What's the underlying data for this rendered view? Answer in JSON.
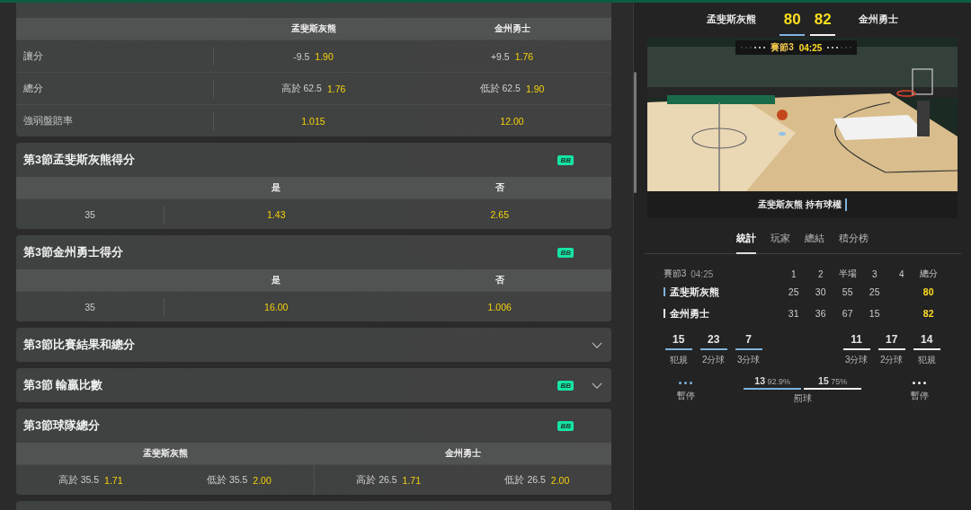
{
  "markets": [
    {
      "kind": "grid",
      "expanded": true,
      "columns": [
        "孟斐斯灰熊",
        "金州勇士"
      ],
      "rows": [
        {
          "label": "讓分",
          "cells": [
            {
              "line": "-9.5",
              "odds": "1.90"
            },
            {
              "line": "+9.5",
              "odds": "1.76"
            }
          ]
        },
        {
          "label": "總分",
          "cells": [
            {
              "line": "高於 62.5",
              "odds": "1.76"
            },
            {
              "line": "低於 62.5",
              "odds": "1.90"
            }
          ]
        },
        {
          "label": "強弱盤賠率",
          "cells": [
            {
              "odds": "1.015"
            },
            {
              "odds": "12.00"
            }
          ]
        }
      ]
    },
    {
      "kind": "line",
      "title": "第3節孟斐斯灰熊得分",
      "badge": "BB",
      "expanded": true,
      "columns": [
        "是",
        "否"
      ],
      "rows": [
        {
          "label": "35",
          "cells": [
            {
              "odds": "1.43"
            },
            {
              "odds": "2.65"
            }
          ]
        }
      ]
    },
    {
      "kind": "line",
      "title": "第3節金州勇士得分",
      "badge": "BB",
      "expanded": true,
      "columns": [
        "是",
        "否"
      ],
      "rows": [
        {
          "label": "35",
          "cells": [
            {
              "odds": "16.00"
            },
            {
              "odds": "1.006"
            }
          ]
        }
      ]
    },
    {
      "kind": "line",
      "title": "第3節比賽結果和總分",
      "expanded": false
    },
    {
      "kind": "line",
      "title": "第3節 輸贏比數",
      "badge": "BB",
      "expanded": false
    },
    {
      "kind": "teams",
      "title": "第3節球隊總分",
      "badge": "BB",
      "expanded": true,
      "columns": [
        "孟斐斯灰熊",
        "金州勇士"
      ],
      "rows": [
        {
          "cells": [
            {
              "line": "高於 35.5",
              "odds": "1.71"
            },
            {
              "line": "低於 35.5",
              "odds": "2.00"
            },
            {
              "line": "高於 26.5",
              "odds": "1.71"
            },
            {
              "line": "低於 26.5",
              "odds": "2.00"
            }
          ]
        }
      ]
    },
    {
      "kind": "stub",
      "expanded": false
    }
  ],
  "match": {
    "teams": [
      {
        "name": "孟斐斯灰熊",
        "score": "80",
        "color": "#7eb3dc"
      },
      {
        "name": "金州勇士",
        "score": "82",
        "color": "#f2f2f2"
      }
    ],
    "clock": {
      "period": "賽節3",
      "time": "04:25"
    },
    "possession": "孟斐斯灰熊 持有球權",
    "tabs": [
      {
        "label": "統計",
        "selected": true
      },
      {
        "label": "玩家",
        "selected": false
      },
      {
        "label": "總結",
        "selected": false
      },
      {
        "label": "積分榜",
        "selected": false
      }
    ],
    "table": {
      "period": "賽節3",
      "time": "04:25",
      "columns": [
        "1",
        "2",
        "半場",
        "3",
        "4",
        "總分"
      ],
      "rows": [
        {
          "team": "孟斐斯灰熊",
          "q1": "25",
          "q2": "30",
          "half": "55",
          "q3": "25",
          "total": "80"
        },
        {
          "team": "金州勇士",
          "q1": "31",
          "q2": "36",
          "half": "67",
          "q3": "15",
          "total": "82"
        }
      ]
    },
    "stats": [
      [
        {
          "value": "15",
          "label": "犯規"
        },
        {
          "value": "23",
          "label": "2分球"
        },
        {
          "value": "7",
          "label": "3分球"
        }
      ],
      [
        {
          "value": "11",
          "label": "3分球"
        },
        {
          "value": "17",
          "label": "2分球"
        },
        {
          "value": "14",
          "label": "犯規"
        }
      ]
    ],
    "timeouts": [
      "暫停",
      "暫停"
    ],
    "free_throws": {
      "label": "罰球",
      "home": {
        "value": "13",
        "pct": "92.9%"
      },
      "away": {
        "value": "15",
        "pct": "75%"
      }
    }
  }
}
